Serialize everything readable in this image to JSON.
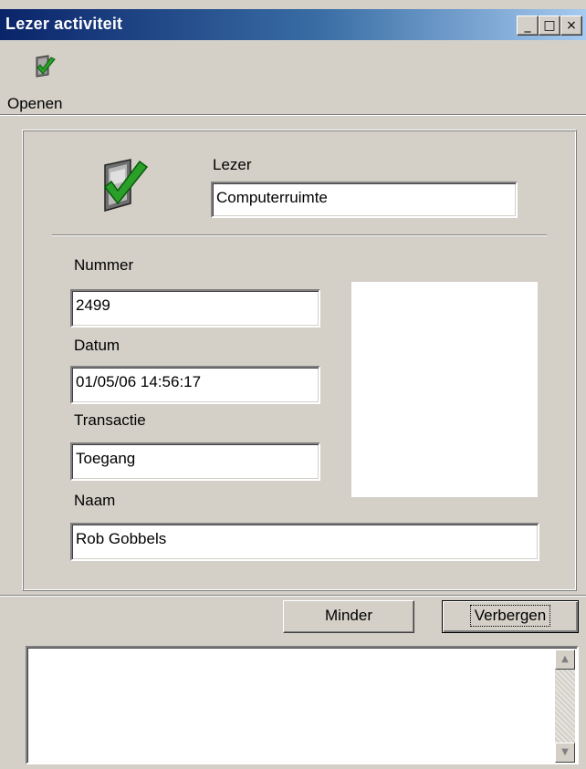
{
  "window": {
    "title": "Lezer activiteit",
    "controls": {
      "minimize": "_",
      "maximize": "□",
      "close": "×"
    }
  },
  "toolbar": {
    "open_label": "Openen",
    "open_icon": "reader-check-icon"
  },
  "reader": {
    "label": "Lezer",
    "value": "Computerruimte",
    "icon": "reader-check-icon"
  },
  "details": {
    "number_label": "Nummer",
    "number_value": "2499",
    "date_label": "Datum",
    "date_value": "01/05/06 14:56:17",
    "transaction_label": "Transactie",
    "transaction_value": "Toegang",
    "name_label": "Naam",
    "name_value": "Rob Gobbels"
  },
  "buttons": {
    "less": "Minder",
    "hide": "Verbergen"
  },
  "scroll": {
    "up": "▲",
    "down": "▼"
  },
  "colors": {
    "titlebar_start": "#0a246a",
    "titlebar_end": "#a6caf0",
    "face": "#d4d0c8",
    "check": "#2aa02a"
  }
}
